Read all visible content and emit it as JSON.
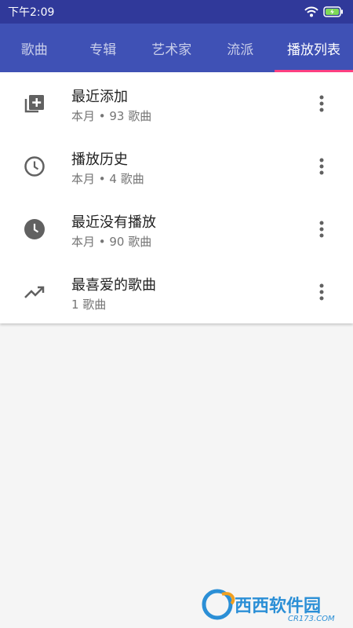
{
  "status_bar": {
    "time": "下午2:09"
  },
  "tabs": [
    {
      "label": "歌曲",
      "active": false
    },
    {
      "label": "专辑",
      "active": false
    },
    {
      "label": "艺术家",
      "active": false
    },
    {
      "label": "流派",
      "active": false
    },
    {
      "label": "播放列表",
      "active": true
    }
  ],
  "playlists": [
    {
      "title": "最近添加",
      "subtitle": "本月 • 93 歌曲",
      "icon": "playlist-add-icon"
    },
    {
      "title": "播放历史",
      "subtitle": "本月 • 4 歌曲",
      "icon": "history-clock-icon"
    },
    {
      "title": "最近没有播放",
      "subtitle": "本月 • 90 歌曲",
      "icon": "clock-filled-icon"
    },
    {
      "title": "最喜爱的歌曲",
      "subtitle": "1 歌曲",
      "icon": "trending-up-icon"
    }
  ],
  "colors": {
    "header": "#3f51b5",
    "status_bar": "#30399a",
    "tab_indicator": "#ff4081"
  },
  "watermark": {
    "text": "西西软件园",
    "url": "CR173.COM"
  }
}
